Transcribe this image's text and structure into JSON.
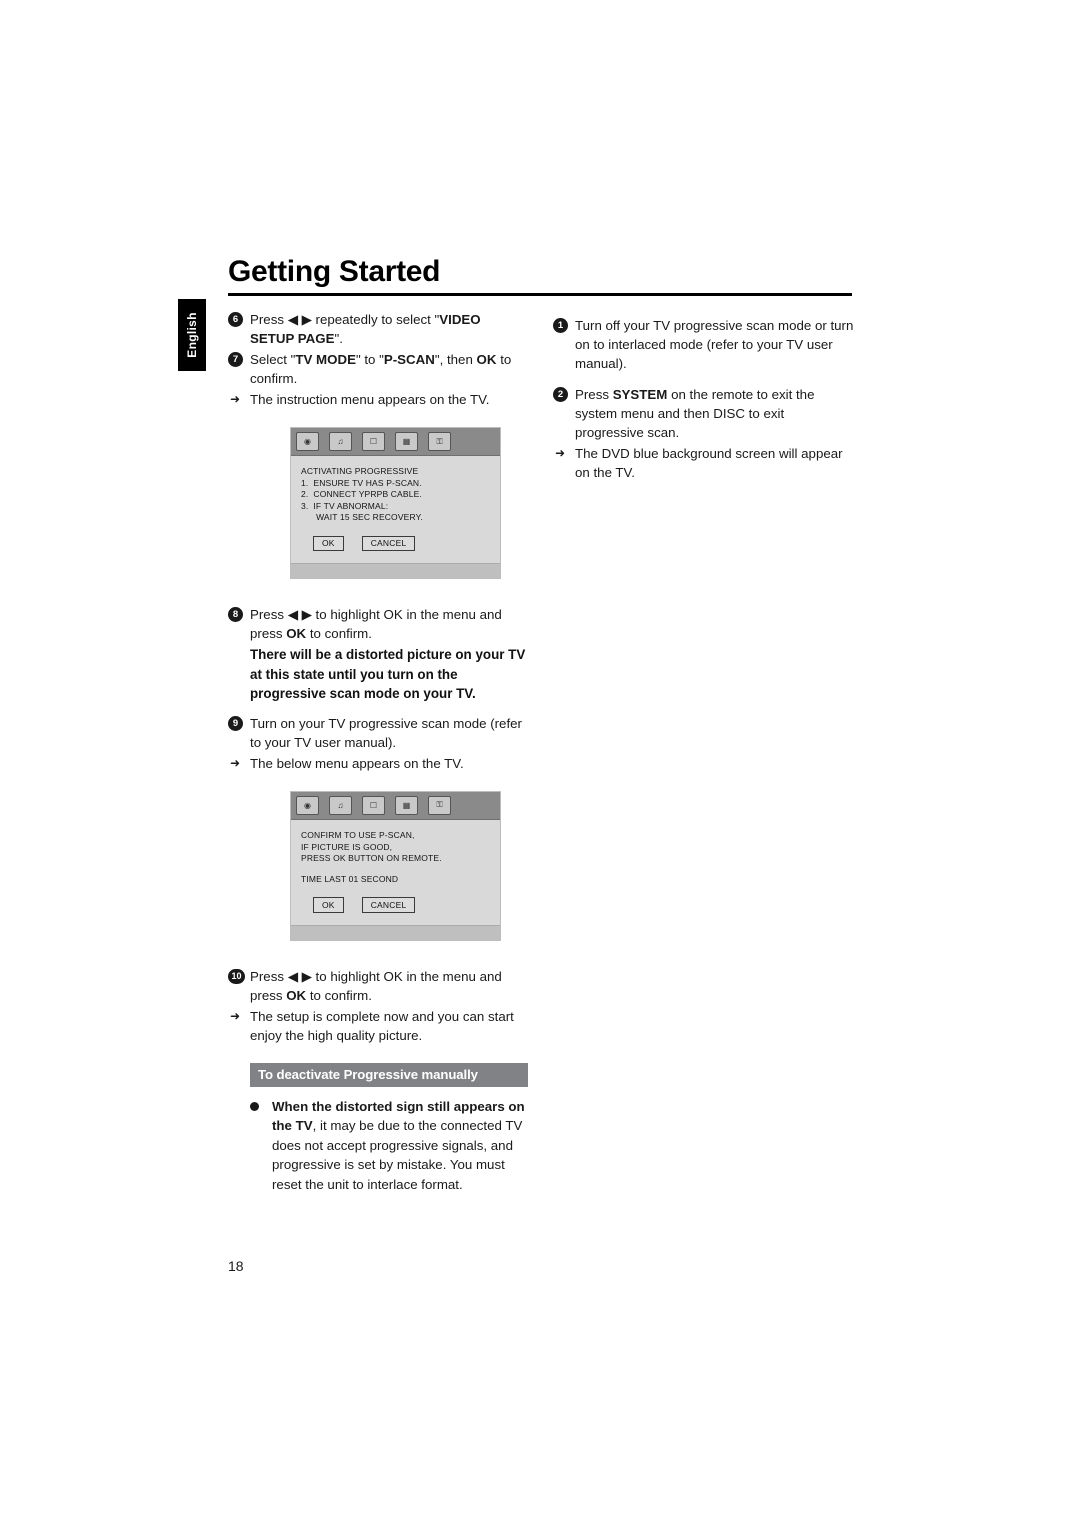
{
  "page": {
    "title": "Getting Started",
    "language_tab": "English",
    "page_number": "18"
  },
  "left_column": {
    "step6": {
      "number": "6",
      "text_1": "Press ",
      "arrows": "◀ ▶",
      "text_2": " repeatedly to select \"",
      "bold_1": "VIDEO SETUP PAGE",
      "text_3": "\"."
    },
    "step7": {
      "number": "7",
      "text_1": "Select \"",
      "bold_1": "TV MODE",
      "text_2": "\" to \"",
      "bold_2": "P-SCAN",
      "text_3": "\", then ",
      "bold_3": "OK",
      "text_4": " to confirm."
    },
    "note7": "The instruction menu appears on the TV.",
    "tv_screen_1": {
      "lines": [
        "ACTIVATING PROGRESSIVE",
        "1.  ENSURE TV HAS P-SCAN.",
        "2.  CONNECT YPRPB CABLE.",
        "3.  IF TV ABNORMAL:",
        "      WAIT 15 SEC RECOVERY."
      ],
      "button_ok": "OK",
      "button_cancel": "CANCEL"
    },
    "step8": {
      "number": "8",
      "text_1": "Press ",
      "arrows": "◀ ▶",
      "text_2": " to highlight OK in the menu and press ",
      "bold_1": "OK",
      "text_3": " to confirm."
    },
    "warning8": "There will be a distorted picture on your TV at this state until you turn on the progressive scan mode on your TV.",
    "step9": {
      "number": "9",
      "text_1": "Turn on your TV progressive scan mode (refer to your TV user manual)."
    },
    "note9": "The below menu appears on the TV.",
    "tv_screen_2": {
      "lines": [
        "CONFIRM TO USE P-SCAN,",
        "IF PICTURE IS GOOD,",
        "PRESS OK BUTTON ON REMOTE."
      ],
      "timer": "TIME LAST 01 SECOND",
      "button_ok": "OK",
      "button_cancel": "CANCEL"
    },
    "step10": {
      "number": "10",
      "text_1": "Press ",
      "arrows": "◀ ▶",
      "text_2": " to highlight OK in the menu and press ",
      "bold_1": "OK",
      "text_3": " to confirm."
    },
    "note10": "The setup is complete now and you can start enjoy the high quality picture.",
    "subheading": "To deactivate Progressive manually",
    "bullet": {
      "bold_1": "When the distorted sign still appears on the TV",
      "text_1": ", it may be due to the connected TV does not accept progressive signals, and progressive is set by mistake. You must reset the unit to interlace format."
    }
  },
  "right_column": {
    "step1": {
      "number": "1",
      "text_1": "Turn off your TV progressive scan mode or turn on to interlaced mode (refer to your TV user manual)."
    },
    "step2": {
      "number": "2",
      "text_1": "Press ",
      "bold_1": "SYSTEM",
      "text_2": " on the remote to exit the system menu and then DISC to exit progressive scan."
    },
    "note2": "The DVD blue background screen will appear on the TV."
  },
  "icons": {
    "tv_bar": [
      "disc-icon",
      "sound-icon",
      "video-icon",
      "preference-icon",
      "lock-icon"
    ]
  }
}
